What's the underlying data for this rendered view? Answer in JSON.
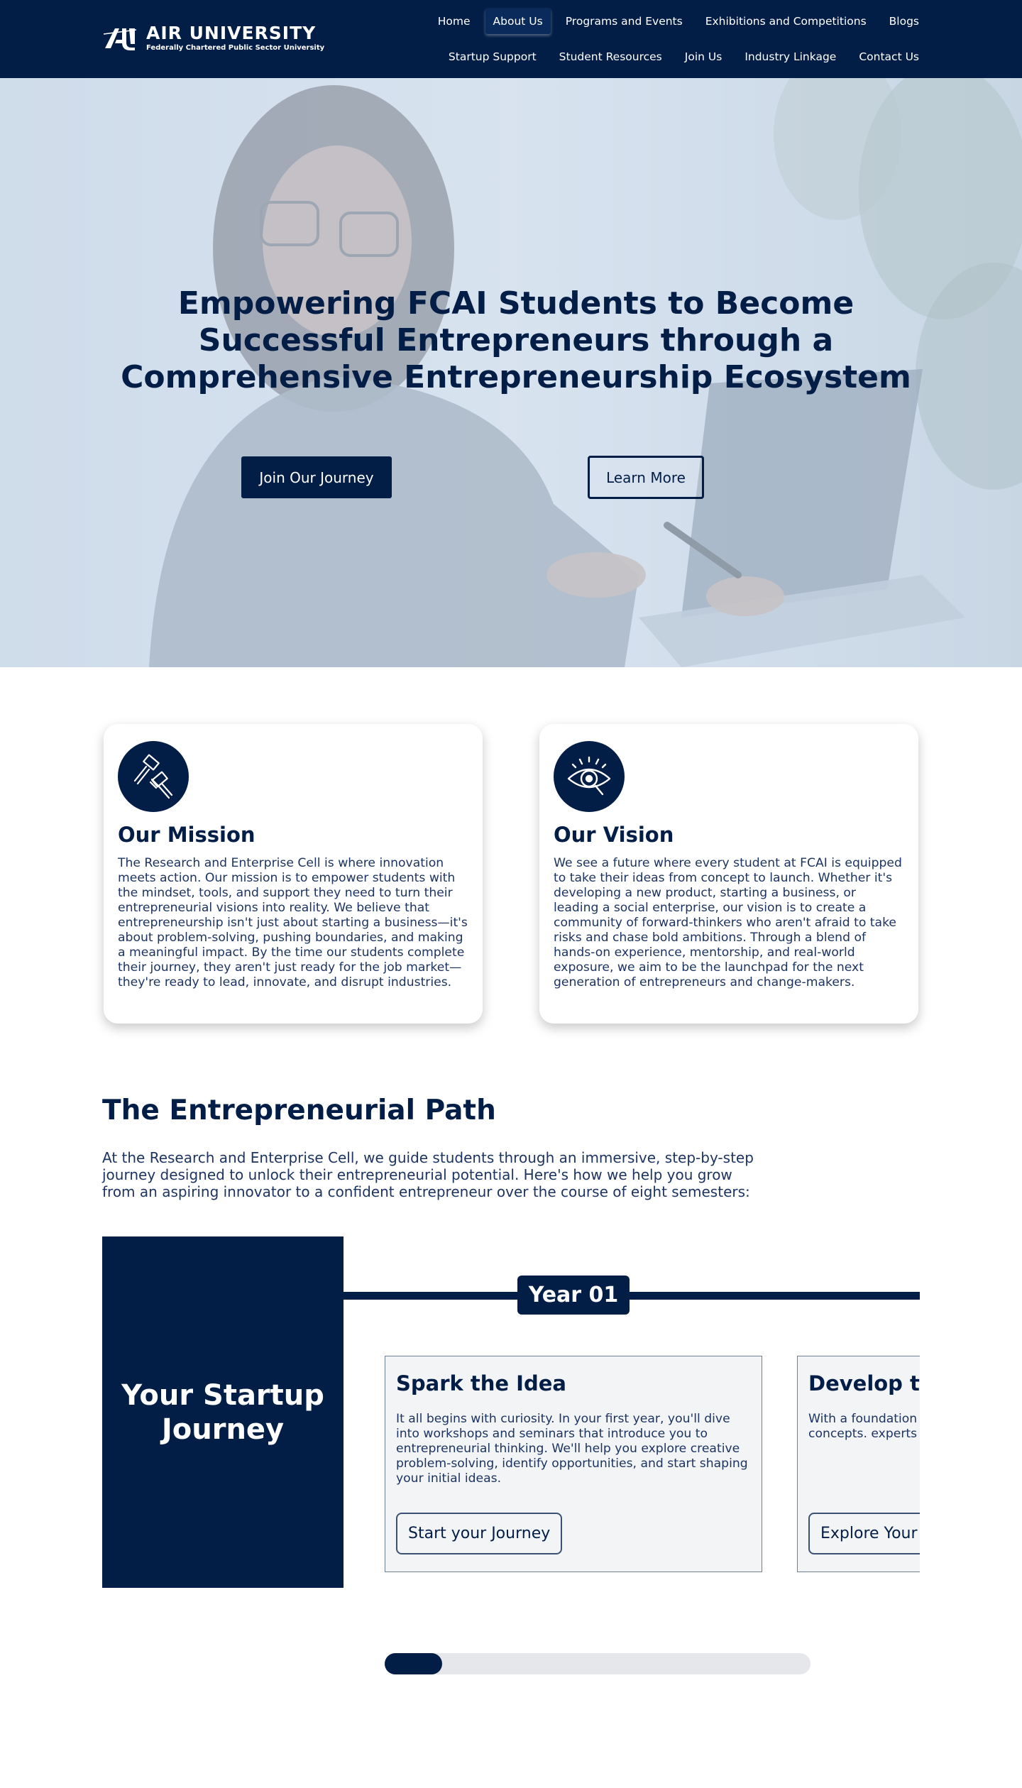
{
  "header": {
    "logo_title": "AIR UNIVERSITY",
    "logo_subtitle": "Federally Chartered Public Sector University",
    "nav_row1": [
      "Home",
      "About Us",
      "Programs and Events",
      "Exhibitions and Competitions",
      "Blogs"
    ],
    "nav_row2": [
      "Startup Support",
      "Student Resources",
      "Join Us",
      "Industry Linkage",
      "Contact Us"
    ],
    "active_item": "About Us"
  },
  "hero": {
    "title": "Empowering FCAI Students to Become Successful Entrepreneurs through a Comprehensive Entrepreneurship Ecosystem",
    "primary_button": "Join Our Journey",
    "secondary_button": "Learn More"
  },
  "mission": {
    "icon": "hammer-icon",
    "title": "Our Mission",
    "text": "The Research and Enterprise Cell is where innovation meets action. Our mission is to empower students with the mindset, tools, and support they need to turn their entrepreneurial visions into reality. We believe that entrepreneurship isn't just about starting a business—it's about problem-solving, pushing boundaries, and making a meaningful impact. By the time our students complete their journey, they aren't just ready for the job market—they're ready to lead, innovate, and disrupt industries."
  },
  "vision": {
    "icon": "eye-icon",
    "title": "Our Vision",
    "text": "We see a future where every student at FCAI is equipped to take their ideas from concept to launch. Whether it's developing a new product, starting a business, or leading a social enterprise, our vision is to create a community of forward-thinkers who aren't afraid to take risks and chase bold ambitions. Through a blend of hands-on experience, mentorship, and real-world exposure, we aim to be the launchpad for the next generation of entrepreneurs and change-makers."
  },
  "path": {
    "title": "The Entrepreneurial Path",
    "text": "At the Research and Enterprise Cell, we guide students through an immersive, step-by-step journey designed to unlock their entrepreneurial potential. Here's how we help you grow from an aspiring innovator to a confident entrepreneur over the course of eight semesters:"
  },
  "journey": {
    "box_title": "Your Startup Journey",
    "year_label": "Year 01",
    "steps": [
      {
        "title": "Spark the Idea",
        "text": "It all begins with curiosity. In your first year, you'll dive into workshops and seminars that introduce you to entrepreneurial thinking. We'll help you explore creative problem-solving, identify opportunities, and start shaping your initial ideas.",
        "button": "Start your Journey"
      },
      {
        "title": "Develop the",
        "text": "With a foundation i teams, begin worki business concepts. experts will provide",
        "button": "Explore Your I"
      }
    ],
    "progress_fraction": 0.135
  },
  "colors": {
    "primary": "#031e46",
    "text": "#1d3461",
    "card_bg": "#f3f4f6",
    "progress_track": "#e6e7eb"
  }
}
